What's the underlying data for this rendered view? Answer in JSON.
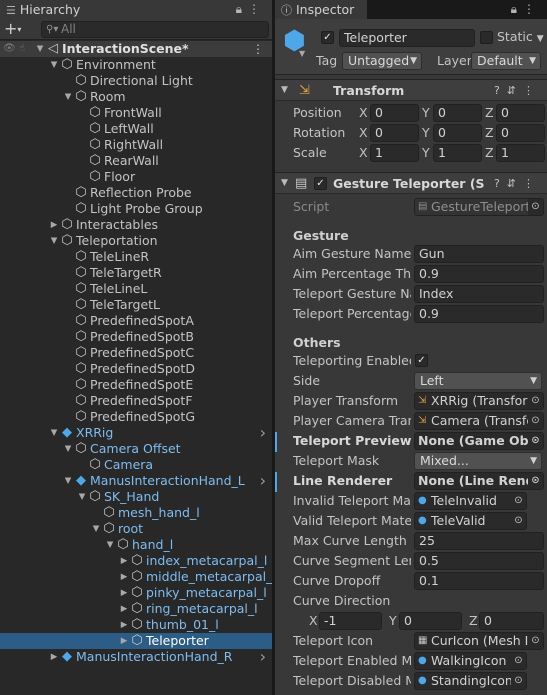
{
  "hierarchy": {
    "tab_label": "Hierarchy",
    "search_placeholder": "All",
    "items": [
      {
        "label": "InteractionScene*",
        "kind": "scene"
      },
      {
        "label": "Environment"
      },
      {
        "label": "Directional Light"
      },
      {
        "label": "Room"
      },
      {
        "label": "FrontWall"
      },
      {
        "label": "LeftWall"
      },
      {
        "label": "RightWall"
      },
      {
        "label": "RearWall"
      },
      {
        "label": "Floor"
      },
      {
        "label": "Reflection Probe"
      },
      {
        "label": "Light Probe Group"
      },
      {
        "label": "Interactables"
      },
      {
        "label": "Teleportation"
      },
      {
        "label": "TeleLineR"
      },
      {
        "label": "TeleTargetR"
      },
      {
        "label": "TeleLineL"
      },
      {
        "label": "TeleTargetL"
      },
      {
        "label": "PredefinedSpotA"
      },
      {
        "label": "PredefinedSpotB"
      },
      {
        "label": "PredefinedSpotC"
      },
      {
        "label": "PredefinedSpotD"
      },
      {
        "label": "PredefinedSpotE"
      },
      {
        "label": "PredefinedSpotF"
      },
      {
        "label": "PredefinedSpotG"
      },
      {
        "label": "XRRig",
        "kind": "prefab"
      },
      {
        "label": "Camera Offset",
        "kind": "prefab-child"
      },
      {
        "label": "Camera",
        "kind": "prefab-child"
      },
      {
        "label": "ManusInteractionHand_L",
        "kind": "prefab"
      },
      {
        "label": "SK_Hand",
        "kind": "prefab-child"
      },
      {
        "label": "mesh_hand_l",
        "kind": "prefab-child"
      },
      {
        "label": "root",
        "kind": "prefab-child"
      },
      {
        "label": "hand_l",
        "kind": "prefab-child"
      },
      {
        "label": "index_metacarpal_l",
        "kind": "prefab-child"
      },
      {
        "label": "middle_metacarpal_l",
        "kind": "prefab-child"
      },
      {
        "label": "pinky_metacarpal_l",
        "kind": "prefab-child"
      },
      {
        "label": "ring_metacarpal_l",
        "kind": "prefab-child"
      },
      {
        "label": "thumb_01_l",
        "kind": "prefab-child"
      },
      {
        "label": "Teleporter",
        "kind": "selected"
      },
      {
        "label": "ManusInteractionHand_R",
        "kind": "prefab"
      }
    ]
  },
  "inspector": {
    "tab_label": "Inspector",
    "object_name": "Teleporter",
    "static_label": "Static",
    "tag_label": "Tag",
    "tag_value": "Untagged",
    "layer_label": "Layer",
    "layer_value": "Default",
    "transform": {
      "title": "Transform",
      "position_label": "Position",
      "rotation_label": "Rotation",
      "scale_label": "Scale",
      "axis_x": "X",
      "axis_y": "Y",
      "axis_z": "Z",
      "position": [
        "0",
        "0",
        "0"
      ],
      "rotation": [
        "0",
        "0",
        "0"
      ],
      "scale": [
        "1",
        "1",
        "1"
      ]
    },
    "gesture": {
      "title": "Gesture Teleporter (Scrip",
      "script_label": "Script",
      "script_value": "GestureTeleport",
      "section_gesture": "Gesture",
      "aim_gesture_name_label": "Aim Gesture Name",
      "aim_gesture_name_value": "Gun",
      "aim_percentage_label": "Aim Percentage Thre",
      "aim_percentage_value": "0.9",
      "teleport_gesture_label": "Teleport Gesture Nar",
      "teleport_gesture_value": "Index",
      "teleport_percentage_label": "Teleport Percentage",
      "teleport_percentage_value": "0.9",
      "section_others": "Others",
      "teleporting_enabled_label": "Teleporting Enabled",
      "teleporting_enabled_check": "✓",
      "side_label": "Side",
      "side_value": "Left",
      "player_transform_label": "Player Transform",
      "player_transform_value": "XRRig (Transforr",
      "player_camera_label": "Player Camera Trans",
      "player_camera_value": "Camera (Transfc",
      "teleport_preview_label": "Teleport Preview",
      "teleport_preview_value": "None (Game Objec",
      "teleport_mask_label": "Teleport Mask",
      "teleport_mask_value": "Mixed...",
      "line_renderer_label": "Line Renderer",
      "line_renderer_value": "None (Line Render",
      "invalid_mat_label": "Invalid Teleport Mate",
      "invalid_mat_value": "TeleInvalid",
      "valid_mat_label": "Valid Teleport Materi",
      "valid_mat_value": "TeleValid",
      "max_curve_label": "Max Curve Length",
      "max_curve_value": "25",
      "curve_segment_label": "Curve Segment Leng",
      "curve_segment_value": "0.5",
      "curve_dropoff_label": "Curve Dropoff",
      "curve_dropoff_value": "0.1",
      "curve_direction_label": "Curve Direction",
      "curve_direction": [
        "-1",
        "0",
        "0"
      ],
      "teleport_icon_label": "Teleport Icon",
      "teleport_icon_value": "CurIcon (Mesh I",
      "enabled_mat_label": "Teleport Enabled Ma",
      "enabled_mat_value": "WalkingIcon",
      "disabled_mat_label": "Teleport Disabled M",
      "disabled_mat_value": "StandingIcon"
    }
  }
}
